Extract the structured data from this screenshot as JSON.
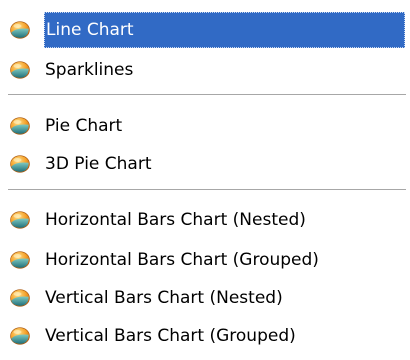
{
  "menu": {
    "items": [
      {
        "label": "Line Chart",
        "icon": "chart-orb-icon",
        "selected": true
      },
      {
        "label": "Sparklines",
        "icon": "chart-orb-icon",
        "selected": false
      },
      {
        "label": "Pie Chart",
        "icon": "chart-orb-icon",
        "selected": false
      },
      {
        "label": "3D Pie Chart",
        "icon": "chart-orb-icon",
        "selected": false
      },
      {
        "label": "Horizontal Bars Chart (Nested)",
        "icon": "chart-orb-icon",
        "selected": false
      },
      {
        "label": "Horizontal Bars Chart (Grouped)",
        "icon": "chart-orb-icon",
        "selected": false
      },
      {
        "label": "Vertical Bars Chart (Nested)",
        "icon": "chart-orb-icon",
        "selected": false
      },
      {
        "label": "Vertical Bars Chart (Grouped)",
        "icon": "chart-orb-icon",
        "selected": false
      }
    ]
  },
  "colors": {
    "selection": "#316ac5",
    "selection_text": "#ffffff",
    "separator": "#a7a7a7",
    "icon_orange": "#f28a12",
    "icon_teal": "#2f8f92"
  }
}
